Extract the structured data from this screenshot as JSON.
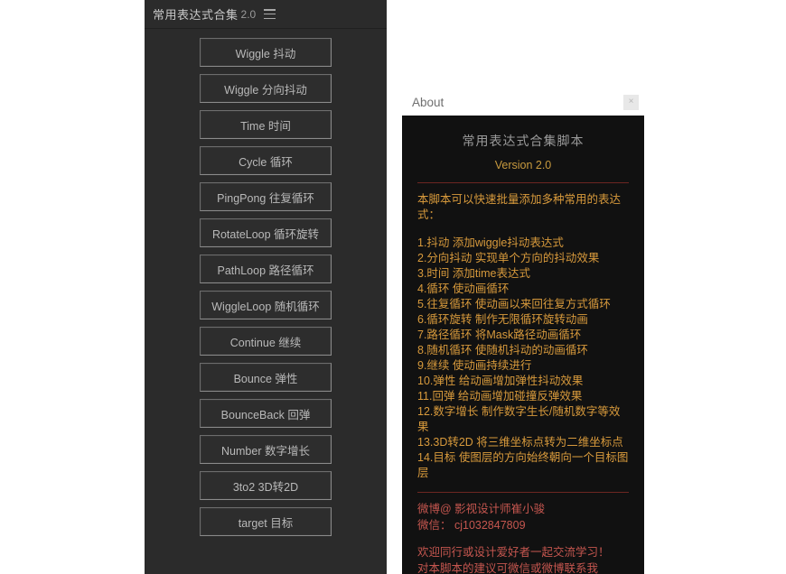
{
  "script_panel": {
    "title": "常用表达式合集",
    "version": "2.0",
    "menu_icon": "hamburger-icon",
    "buttons": [
      "Wiggle 抖动",
      "Wiggle 分向抖动",
      "Time 时间",
      "Cycle 循环",
      "PingPong 往复循环",
      "RotateLoop 循环旋转",
      "PathLoop 路径循环",
      "WiggleLoop 随机循环",
      "Continue 继续",
      "Bounce 弹性",
      "BounceBack 回弹",
      "Number 数字增长",
      "3to2 3D转2D",
      "target 目标"
    ]
  },
  "about_window": {
    "titlebar_label": "About",
    "close_icon": "close-icon",
    "close_label": "×",
    "heading": "常用表达式合集脚本",
    "version_label": "Version 2.0",
    "intro": "本脚本可以快速批量添加多种常用的表达式：",
    "features": [
      "1.抖动  添加wiggle抖动表达式",
      "2.分向抖动  实现单个方向的抖动效果",
      "3.时间  添加time表达式",
      "4.循环  使动画循环",
      "5.往复循环  使动画以来回往复方式循环",
      "6.循环旋转  制作无限循环旋转动画",
      "7.路径循环  将Mask路径动画循环",
      "8.随机循环  使随机抖动的动画循环",
      "9.继续  使动画持续进行",
      "10.弹性  给动画增加弹性抖动效果",
      "11.回弹  给动画增加碰撞反弹效果",
      "12.数字增长   制作数字生长/随机数字等效果",
      "13.3D转2D   将三维坐标点转为二维坐标点",
      "14.目标  使图层的方向始终朝向一个目标图层"
    ],
    "contact_weibo": "微博@ 影视设计师崔小骏",
    "contact_wechat": "微信： cj1032847809",
    "welcome_line1": "欢迎同行或设计爱好者一起交流学习！",
    "welcome_line2": "对本脚本的建议可微信或微博联系我"
  },
  "colors": {
    "panel_bg": "#2b2b2b",
    "about_bg": "#111111",
    "amber_text": "#d89a3c",
    "red_text": "#c5564f",
    "divider": "#6d2622",
    "button_text": "#b9b9b9"
  }
}
